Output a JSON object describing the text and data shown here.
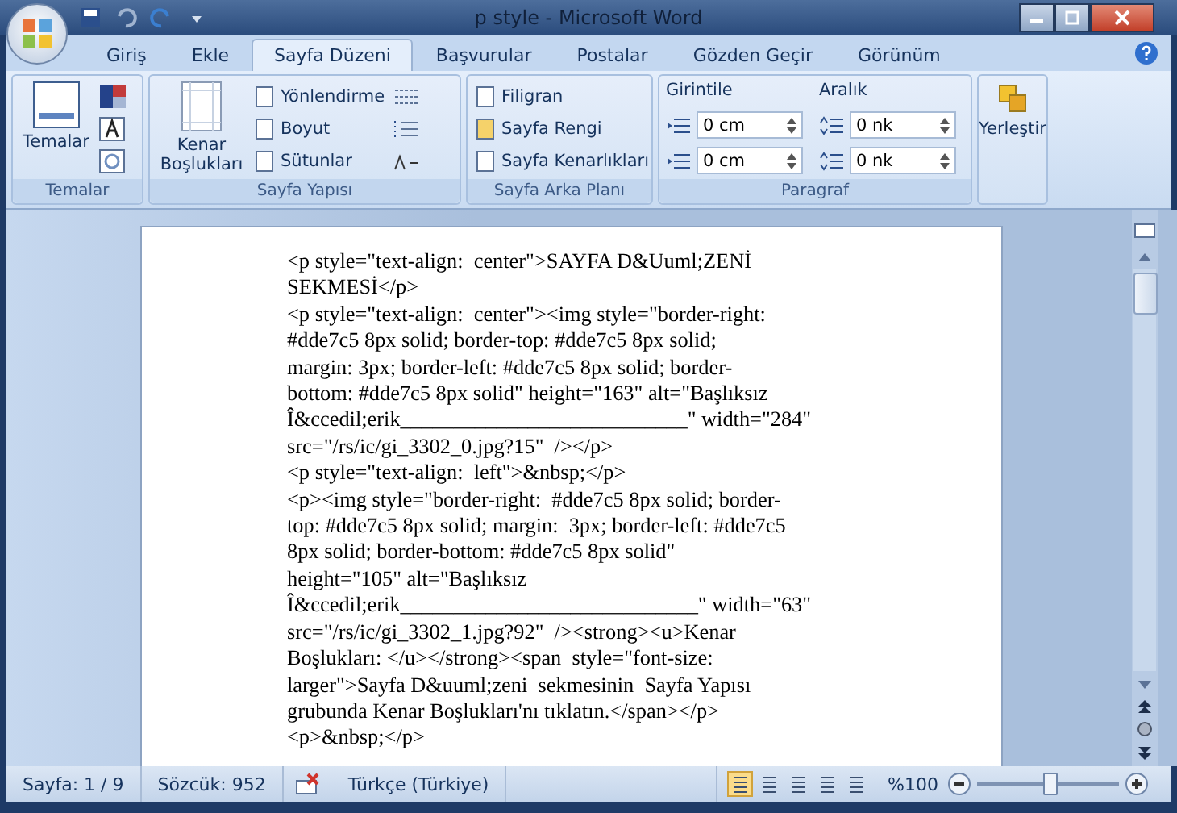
{
  "window": {
    "title": "p style - Microsoft Word"
  },
  "tabs": [
    {
      "label": "Giriş",
      "selected": false
    },
    {
      "label": "Ekle",
      "selected": false
    },
    {
      "label": "Sayfa Düzeni",
      "selected": true
    },
    {
      "label": "Başvurular",
      "selected": false
    },
    {
      "label": "Postalar",
      "selected": false
    },
    {
      "label": "Gözden Geçir",
      "selected": false
    },
    {
      "label": "Görünüm",
      "selected": false
    }
  ],
  "ribbon": {
    "themes": {
      "button": "Temalar",
      "group": "Temalar"
    },
    "page_setup": {
      "big_button": "Kenar Boşlukları",
      "items": [
        "Yönlendirme",
        "Boyut",
        "Sütunlar"
      ],
      "group": "Sayfa Yapısı"
    },
    "page_background": {
      "items": [
        "Filigran",
        "Sayfa Rengi",
        "Sayfa Kenarlıkları"
      ],
      "group": "Sayfa Arka Planı"
    },
    "paragraph": {
      "indent_label": "Girintile",
      "indent": [
        "0 cm",
        "0 cm"
      ],
      "spacing_label": "Aralık",
      "spacing": [
        "0 nk",
        "0 nk"
      ],
      "group": "Paragraf"
    },
    "arrange": "Yerleştir"
  },
  "document": {
    "lines": [
      "<p style=\"text-align:  center\">SAYFA D&Uuml;ZENİ",
      "SEKMESİ</p>",
      "<p style=\"text-align:  center\"><img style=\"border-right:",
      "#dde7c5 8px solid; border-top: #dde7c5 8px solid;",
      "margin: 3px; border-left: #dde7c5 8px solid; border-",
      "bottom: #dde7c5 8px solid\" height=\"163\" alt=\"Başlıksız",
      "Î&ccedil;erik___________________________\" width=\"284\"",
      "src=\"/rs/ic/gi_3302_0.jpg?15\"  /></p>",
      "<p style=\"text-align:  left\">&nbsp;</p>",
      "<p><img style=\"border-right:  #dde7c5 8px solid; border-",
      "top: #dde7c5 8px solid; margin:  3px; border-left: #dde7c5",
      "8px solid; border-bottom: #dde7c5 8px solid\"",
      "height=\"105\" alt=\"Başlıksız",
      "Î&ccedil;erik____________________________\" width=\"63\"",
      "src=\"/rs/ic/gi_3302_1.jpg?92\"  /><strong><u>Kenar",
      "Boşlukları: </u></strong><span  style=\"font-size:",
      "larger\">Sayfa D&uuml;zeni  sekmesinin  Sayfa Yapısı",
      "grubunda Kenar Boşlukları'nı tıklatın.</span></p>",
      "<p>&nbsp;</p>"
    ]
  },
  "status_bar": {
    "page": "Sayfa: 1 / 9",
    "words": "Sözcük: 952",
    "language": "Türkçe (Türkiye)",
    "views": [
      {
        "selected": true
      },
      {
        "selected": false
      },
      {
        "selected": false
      },
      {
        "selected": false
      },
      {
        "selected": false
      }
    ],
    "zoom": "%100",
    "zoom_slider": {
      "level": 0.5
    }
  }
}
